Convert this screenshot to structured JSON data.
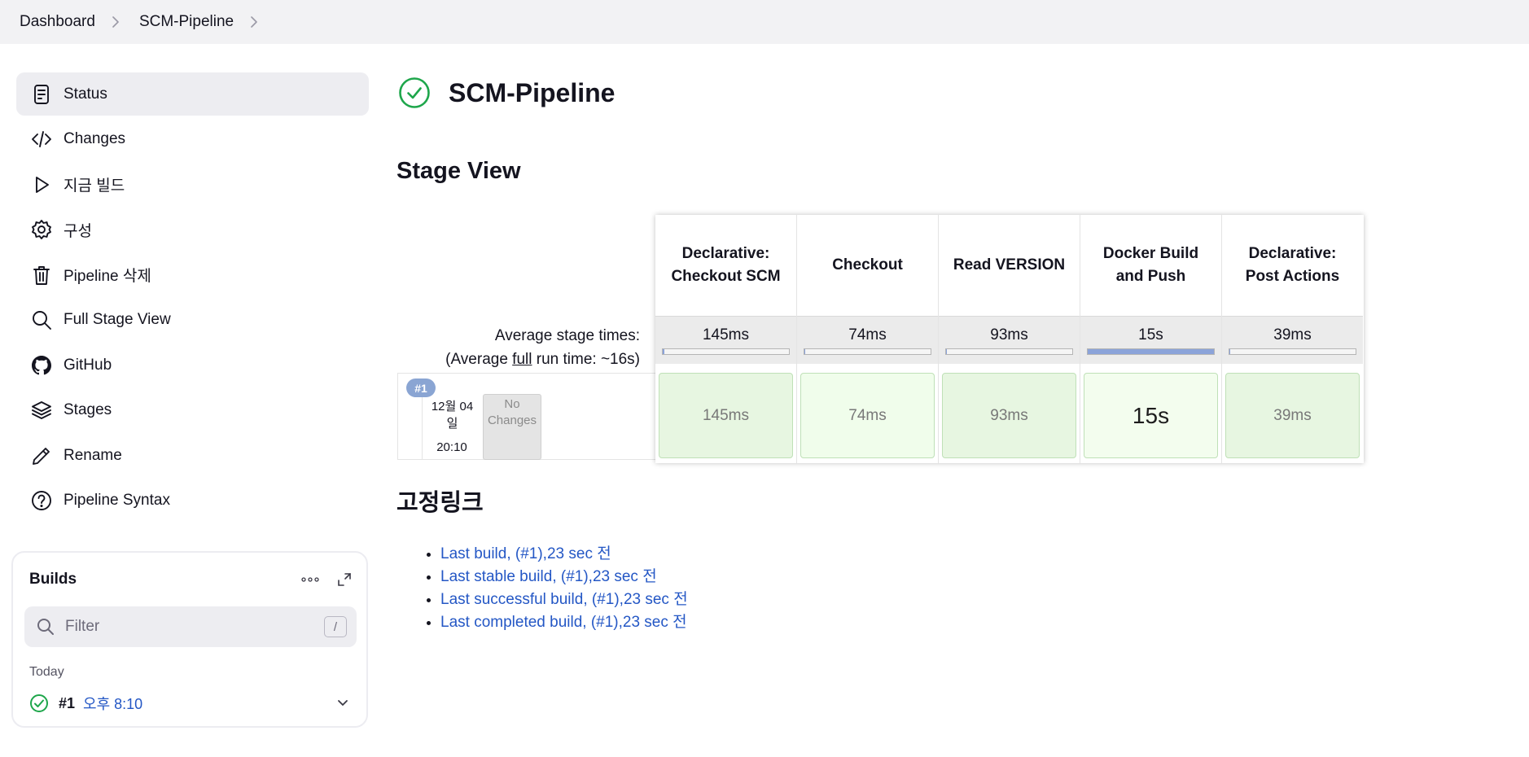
{
  "breadcrumb": {
    "items": [
      "Dashboard",
      "SCM-Pipeline"
    ]
  },
  "sidebar": {
    "items": [
      {
        "label": "Status",
        "icon": "status-icon",
        "active": true
      },
      {
        "label": "Changes",
        "icon": "code-icon"
      },
      {
        "label": "지금 빌드",
        "icon": "play-icon"
      },
      {
        "label": "구성",
        "icon": "gear-icon"
      },
      {
        "label": "Pipeline 삭제",
        "icon": "trash-icon"
      },
      {
        "label": "Full Stage View",
        "icon": "search-icon"
      },
      {
        "label": "GitHub",
        "icon": "github-icon"
      },
      {
        "label": "Stages",
        "icon": "layers-icon"
      },
      {
        "label": "Rename",
        "icon": "pencil-icon"
      },
      {
        "label": "Pipeline Syntax",
        "icon": "help-icon"
      }
    ]
  },
  "builds": {
    "title": "Builds",
    "filter_placeholder": "Filter",
    "shortcut": "/",
    "group": "Today",
    "entries": [
      {
        "number": "#1",
        "time": "오후 8:10",
        "status": "success"
      }
    ]
  },
  "main": {
    "title": "SCM-Pipeline",
    "status_color": "#1ea64b",
    "stage_view_heading": "Stage View"
  },
  "stage_view": {
    "avg_label_line1": "Average stage times:",
    "avg_label_line2_pre": "(Average ",
    "avg_label_line2_link": "full",
    "avg_label_line2_post": " run time: ~16s)",
    "stages": [
      {
        "name": "Declarative: Checkout SCM",
        "avg": "145ms",
        "bar_fraction": 0.01,
        "run": "145ms"
      },
      {
        "name": "Checkout",
        "avg": "74ms",
        "bar_fraction": 0.005,
        "run": "74ms"
      },
      {
        "name": "Read VERSION",
        "avg": "93ms",
        "bar_fraction": 0.006,
        "run": "93ms"
      },
      {
        "name": "Docker Build and Push",
        "avg": "15s",
        "bar_fraction": 1.0,
        "run": "15s"
      },
      {
        "name": "Declarative: Post Actions",
        "avg": "39ms",
        "bar_fraction": 0.003,
        "run": "39ms"
      }
    ],
    "run": {
      "badge": "#1",
      "date_line1": "12월 04",
      "date_line2": "일",
      "time": "20:10",
      "changes": "No Changes"
    }
  },
  "permalinks": {
    "heading": "고정링크",
    "links": [
      "Last build, (#1),23 sec 전",
      "Last stable build, (#1),23 sec 전",
      "Last successful build, (#1),23 sec 전",
      "Last completed build, (#1),23 sec 전"
    ]
  }
}
